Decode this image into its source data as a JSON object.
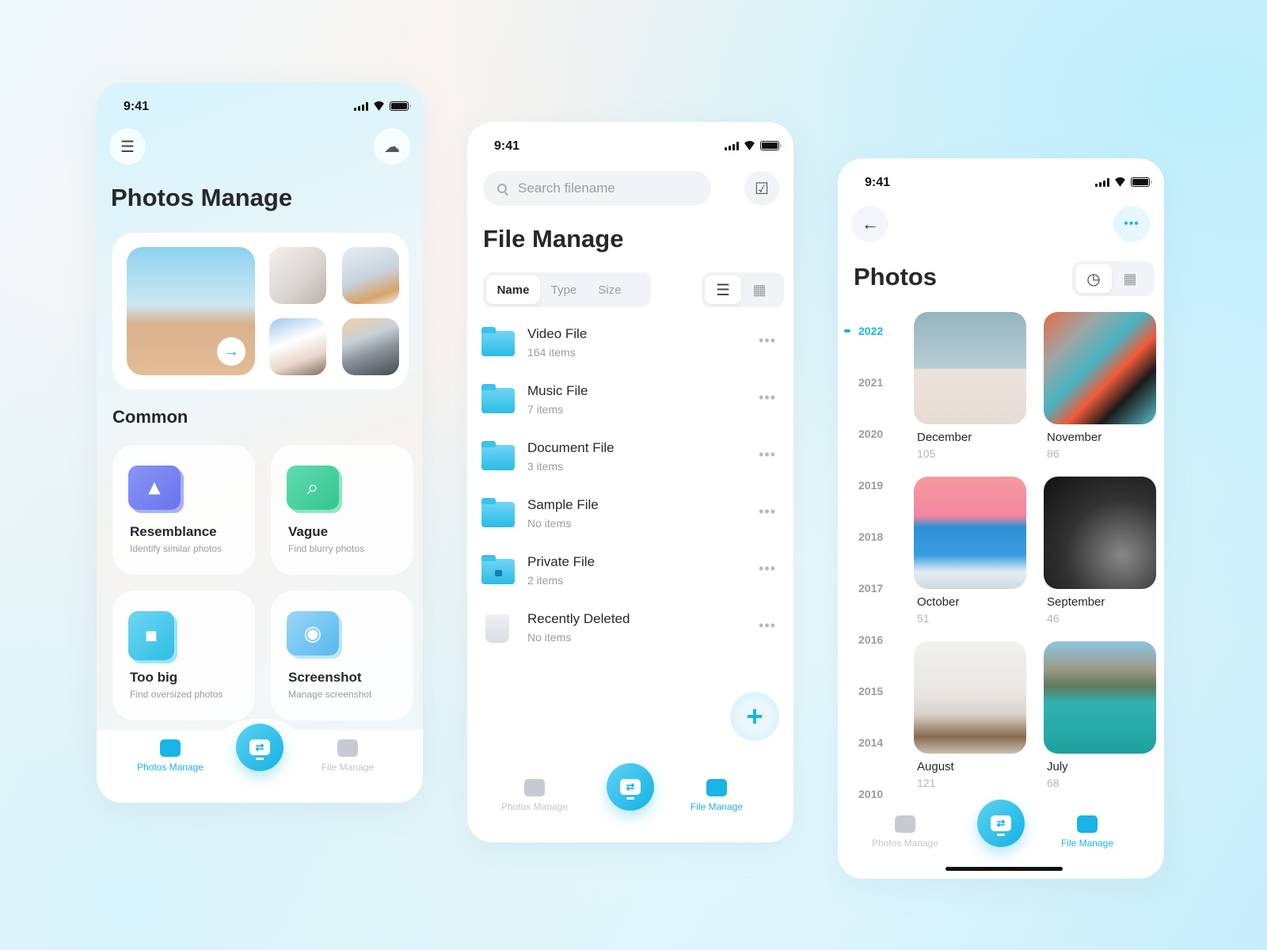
{
  "status": {
    "time": "9:41"
  },
  "phone1": {
    "title": "Photos Manage",
    "menu_icon": "menu-icon",
    "cloud_icon": "cloud-icon",
    "section_title": "Common",
    "cards": [
      {
        "title": "Resemblance",
        "subtitle": "Identify similar photos",
        "icon": "image-icon"
      },
      {
        "title": "Vague",
        "subtitle": "Find blurry photos",
        "icon": "search-icon"
      },
      {
        "title": "Too big",
        "subtitle": "Find oversized photos",
        "icon": "expand-icon"
      },
      {
        "title": "Screenshot",
        "subtitle": "Manage screenshot",
        "icon": "camera-icon"
      }
    ],
    "tabs": {
      "photos": "Photos Manage",
      "files": "File Manage",
      "active": "photos"
    }
  },
  "phone2": {
    "search_placeholder": "Search filename",
    "title": "File Manage",
    "sort": [
      "Name",
      "Type",
      "Size"
    ],
    "sort_selected": "Name",
    "view_modes": [
      "list",
      "grid"
    ],
    "files": [
      {
        "name": "Video File",
        "count": "164 items",
        "icon": "folder-icon"
      },
      {
        "name": "Music File",
        "count": "7 items",
        "icon": "folder-icon"
      },
      {
        "name": "Document File",
        "count": "3 items",
        "icon": "folder-icon"
      },
      {
        "name": "Sample File",
        "count": "No items",
        "icon": "folder-icon"
      },
      {
        "name": "Private File",
        "count": "2 items",
        "icon": "locked-folder-icon"
      },
      {
        "name": "Recently Deleted",
        "count": "No items",
        "icon": "trash-icon"
      }
    ],
    "more": "•••",
    "add": "+",
    "tabs": {
      "photos": "Photos Manage",
      "files": "File Manage",
      "active": "files"
    }
  },
  "phone3": {
    "title": "Photos",
    "more": "•••",
    "years": [
      "2022",
      "2021",
      "2020",
      "2019",
      "2018",
      "2017",
      "2016",
      "2015",
      "2014",
      "2010"
    ],
    "active_year": "2022",
    "months": [
      {
        "name": "December",
        "count": "105"
      },
      {
        "name": "November",
        "count": "86"
      },
      {
        "name": "October",
        "count": "51"
      },
      {
        "name": "September",
        "count": "46"
      },
      {
        "name": "August",
        "count": "121"
      },
      {
        "name": "July",
        "count": "68"
      }
    ],
    "tabs": {
      "photos": "Photos Manage",
      "files": "File Manage",
      "active": "files"
    }
  },
  "colors": {
    "accent": "#1ab4e6",
    "text": "#26282c",
    "muted": "#9a9ca1"
  }
}
